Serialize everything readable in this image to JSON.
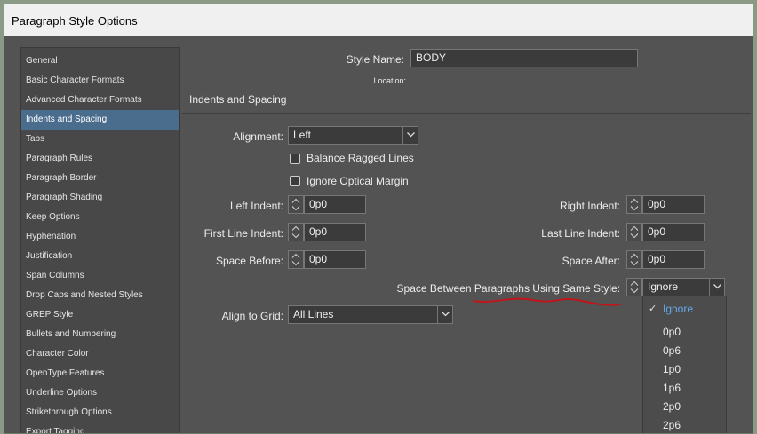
{
  "window": {
    "title": "Paragraph Style Options"
  },
  "sidebar": {
    "items": [
      {
        "label": "General"
      },
      {
        "label": "Basic Character Formats"
      },
      {
        "label": "Advanced Character Formats"
      },
      {
        "label": "Indents and Spacing",
        "selected": true
      },
      {
        "label": "Tabs"
      },
      {
        "label": "Paragraph Rules"
      },
      {
        "label": "Paragraph Border"
      },
      {
        "label": "Paragraph Shading"
      },
      {
        "label": "Keep Options"
      },
      {
        "label": "Hyphenation"
      },
      {
        "label": "Justification"
      },
      {
        "label": "Span Columns"
      },
      {
        "label": "Drop Caps and Nested Styles"
      },
      {
        "label": "GREP Style"
      },
      {
        "label": "Bullets and Numbering"
      },
      {
        "label": "Character Color"
      },
      {
        "label": "OpenType Features"
      },
      {
        "label": "Underline Options"
      },
      {
        "label": "Strikethrough Options"
      },
      {
        "label": "Export Tagging"
      }
    ]
  },
  "header": {
    "style_name_label": "Style Name:",
    "style_name_value": "BODY",
    "location_label": "Location:",
    "section_title": "Indents and Spacing"
  },
  "form": {
    "alignment_label": "Alignment:",
    "alignment_value": "Left",
    "balance_ragged_label": "Balance Ragged Lines",
    "balance_ragged_checked": false,
    "ignore_optical_label": "Ignore Optical Margin",
    "ignore_optical_checked": false,
    "left_indent_label": "Left Indent:",
    "left_indent_value": "0p0",
    "right_indent_label": "Right Indent:",
    "right_indent_value": "0p0",
    "first_line_label": "First Line Indent:",
    "first_line_value": "0p0",
    "last_line_label": "Last Line Indent:",
    "last_line_value": "0p0",
    "space_before_label": "Space Before:",
    "space_before_value": "0p0",
    "space_after_label": "Space After:",
    "space_after_value": "0p0",
    "space_between_label": "Space Between Paragraphs Using Same Style:",
    "space_between_value": "Ignore",
    "align_grid_label": "Align to Grid:",
    "align_grid_value": "All Lines"
  },
  "popup": {
    "options": [
      "Ignore",
      "0p0",
      "0p6",
      "1p0",
      "1p6",
      "2p0",
      "2p6"
    ],
    "selected": "Ignore"
  },
  "colors": {
    "selection": "#4b6d8d",
    "annotation_underline": "#c0151b",
    "selected_option": "#67a7ea"
  },
  "icons": [
    "chevron-down-icon",
    "spinner-arrows-icon",
    "checkmark-icon"
  ]
}
